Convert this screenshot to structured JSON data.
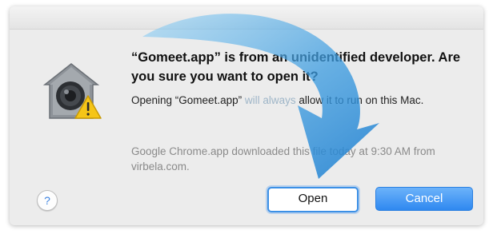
{
  "dialog": {
    "title": "“Gomeet.app” is from an unidentified developer. Are you sure you want to open it?",
    "message_prefix": "Opening ",
    "message_app": "“Gomeet.app”",
    "message_faded": " will always",
    "message_suffix": " allow it to run on this Mac.",
    "source_text": "Google Chrome.app downloaded this file today at 9:30 AM from virbela.com.",
    "icon": "gatekeeper-warning-icon"
  },
  "buttons": {
    "help_label": "?",
    "open_label": "Open",
    "cancel_label": "Cancel"
  },
  "annotation": {
    "icon": "curved-arrow-icon",
    "color": "#3a9be0"
  },
  "colors": {
    "accent": "#3c90e6",
    "dialog_bg": "#ececec",
    "warning_yellow": "#f5c518"
  }
}
